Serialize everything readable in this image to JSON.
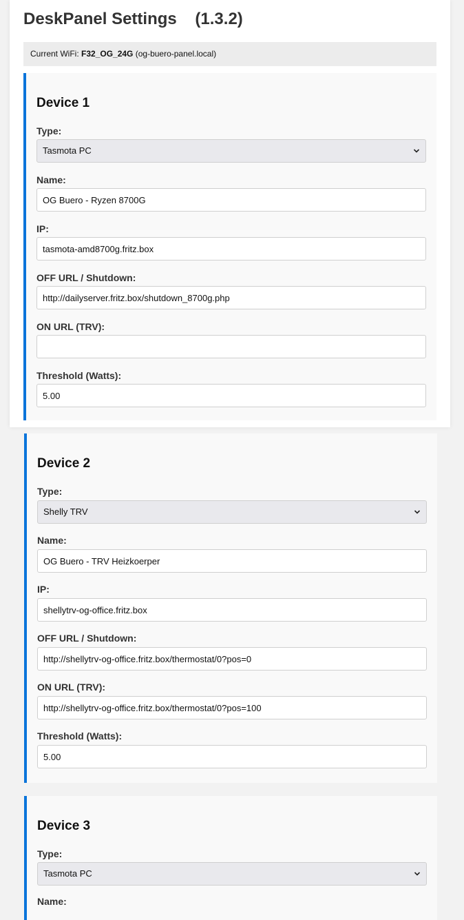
{
  "header": {
    "title": "DeskPanel Settings",
    "version": "(1.3.2)"
  },
  "wifi": {
    "label": "Current WiFi:",
    "ssid": "F32_OG_24G",
    "hostname": "(og-buero-panel.local)"
  },
  "labels": {
    "type": "Type:",
    "name": "Name:",
    "ip": "IP:",
    "off_url": "OFF URL / Shutdown:",
    "on_url": "ON URL (TRV):",
    "threshold": "Threshold (Watts):"
  },
  "devices": [
    {
      "title": "Device 1",
      "type": "Tasmota PC",
      "name": "OG Buero - Ryzen 8700G",
      "ip": "tasmota-amd8700g.fritz.box",
      "off_url": "http://dailyserver.fritz.box/shutdown_8700g.php",
      "on_url": "",
      "threshold": "5.00"
    },
    {
      "title": "Device 2",
      "type": "Shelly TRV",
      "name": "OG Buero - TRV Heizkoerper",
      "ip": "shellytrv-og-office.fritz.box",
      "off_url": "http://shellytrv-og-office.fritz.box/thermostat/0?pos=0",
      "on_url": "http://shellytrv-og-office.fritz.box/thermostat/0?pos=100",
      "threshold": "5.00"
    },
    {
      "title": "Device 3",
      "type": "Tasmota PC"
    }
  ]
}
